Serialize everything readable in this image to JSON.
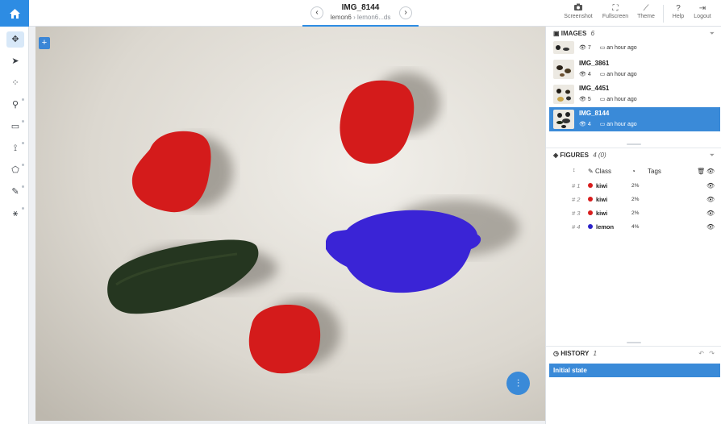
{
  "header": {
    "title": "IMG_8144",
    "breadcrumb_project": "lemon6",
    "breadcrumb_separator": "›",
    "breadcrumb_dataset": "lemon6...ds",
    "prev_icon": "chevron-left-icon",
    "next_icon": "chevron-right-icon",
    "tools": [
      {
        "label": "Screenshot",
        "icon": "camera-icon"
      },
      {
        "label": "Fullscreen",
        "icon": "fullscreen-icon"
      },
      {
        "label": "Theme",
        "icon": "theme-icon"
      },
      {
        "label": "Help",
        "icon": "help-icon"
      },
      {
        "label": "Logout",
        "icon": "logout-icon"
      }
    ],
    "accent_color": "#2d8ce3"
  },
  "left_tools": [
    {
      "name": "pan-tool",
      "icon": "move-icon",
      "active": true
    },
    {
      "name": "select-tool",
      "icon": "pointer-icon"
    },
    {
      "name": "points-tool",
      "icon": "points-icon"
    },
    {
      "name": "skeleton-tool",
      "icon": "skeleton-icon"
    },
    {
      "name": "rectangle-tool",
      "icon": "rectangle-icon"
    },
    {
      "name": "polyline-tool",
      "icon": "polyline-icon"
    },
    {
      "name": "polygon-tool",
      "icon": "polygon-icon"
    },
    {
      "name": "brush-tool",
      "icon": "brush-icon"
    },
    {
      "name": "smart-tool",
      "icon": "magic-wand-icon"
    }
  ],
  "images_panel": {
    "title": "IMAGES",
    "count": "6",
    "items": [
      {
        "name": "",
        "figures": "7",
        "time": "an hour ago",
        "selected": false
      },
      {
        "name": "IMG_3861",
        "figures": "4",
        "time": "an hour ago",
        "selected": false
      },
      {
        "name": "IMG_4451",
        "figures": "5",
        "time": "an hour ago",
        "selected": false
      },
      {
        "name": "IMG_8144",
        "figures": "4",
        "time": "an hour ago",
        "selected": true
      }
    ]
  },
  "figures_panel": {
    "title": "FIGURES",
    "count": "4 (0)",
    "col_class": "Class",
    "col_tags": "Tags",
    "rows": [
      {
        "num": "# 1",
        "class": "kiwi",
        "color": "#d81d1d",
        "area": "2%"
      },
      {
        "num": "# 2",
        "class": "kiwi",
        "color": "#d81d1d",
        "area": "2%"
      },
      {
        "num": "# 3",
        "class": "kiwi",
        "color": "#d81d1d",
        "area": "2%"
      },
      {
        "num": "# 4",
        "class": "lemon",
        "color": "#2b22c8",
        "area": "4%"
      }
    ]
  },
  "history_panel": {
    "title": "HISTORY",
    "count": "1",
    "items": [
      "Initial state"
    ]
  },
  "colors": {
    "kiwi": "#d81d1d",
    "lemon": "#3a24d6",
    "selection": "#3a8ad8"
  }
}
